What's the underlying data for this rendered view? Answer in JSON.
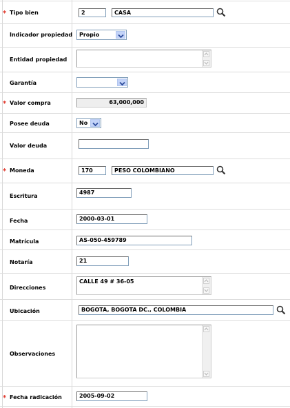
{
  "form": {
    "tipo_bien": {
      "label": "Tipo bien",
      "code": "2",
      "name": "CASA"
    },
    "indicador_propiedad": {
      "label": "Indicador propiedad",
      "value": "Propio"
    },
    "entidad_propiedad": {
      "label": "Entidad propiedad",
      "value": ""
    },
    "garantia": {
      "label": "Garantía",
      "value": ""
    },
    "valor_compra": {
      "label": "Valor compra",
      "value": "63,000,000"
    },
    "posee_deuda": {
      "label": "Posee deuda",
      "value": "No"
    },
    "valor_deuda": {
      "label": "Valor deuda",
      "value": ""
    },
    "moneda": {
      "label": "Moneda",
      "code": "170",
      "name": "PESO COLOMBIANO"
    },
    "escritura": {
      "label": "Escritura",
      "value": "4987"
    },
    "fecha": {
      "label": "Fecha",
      "value": "2000-03-01"
    },
    "matricula": {
      "label": "Matrícula",
      "value": "AS-050-459789"
    },
    "notaria": {
      "label": "Notaría",
      "value": "21"
    },
    "direcciones": {
      "label": "Direcciones",
      "value": "CALLE 49 # 36-05"
    },
    "ubicacion": {
      "label": "Ubicación",
      "value": "BOGOTA, BOGOTA DC., COLOMBIA"
    },
    "observaciones": {
      "label": "Observaciones",
      "value": ""
    },
    "fecha_radicacion": {
      "label": "Fecha radicación",
      "value": "2005-09-02"
    }
  },
  "required_marker": "*",
  "icons": {
    "search": "magnifier-icon",
    "dropdown": "chevron-down-icon",
    "scroll_up": "scroll-up-arrow",
    "scroll_down": "scroll-down-arrow"
  },
  "colors": {
    "required": "#e0362a",
    "dropdown_button": "#c3d3f8",
    "field_border": "#7f9db9",
    "divider": "#dcdcdc"
  }
}
